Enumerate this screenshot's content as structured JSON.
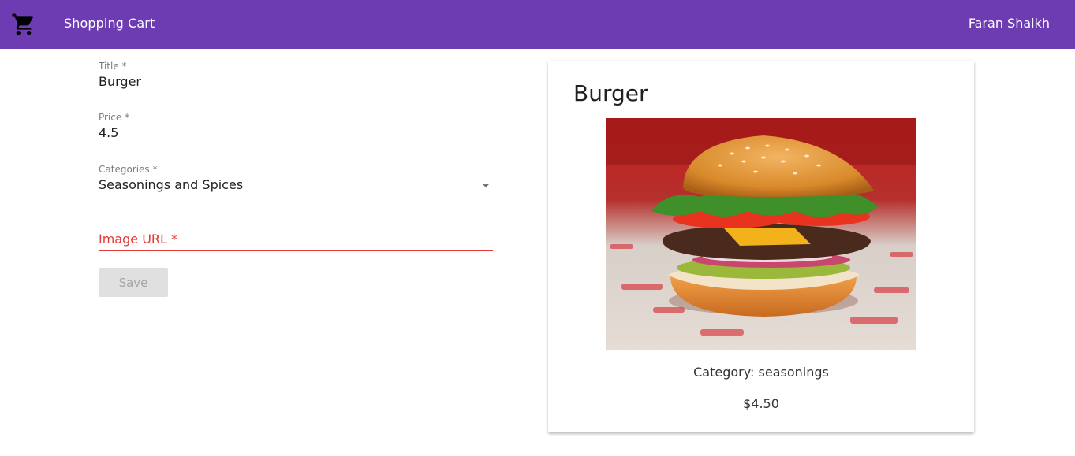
{
  "app": {
    "brand": "Shopping Cart",
    "user_name": "Faran Shaikh",
    "toolbar_color": "#6d3bb2",
    "cart_icon": "shopping-cart-icon"
  },
  "form": {
    "title": {
      "label": "Title *",
      "value": "Burger"
    },
    "price": {
      "label": "Price *",
      "value": "4.5"
    },
    "categories": {
      "label": "Categories *",
      "value": "Seasonings and Spices"
    },
    "image_url": {
      "placeholder": "Image URL *",
      "value": ""
    },
    "save_label": "Save",
    "error_color": "#e53935"
  },
  "preview": {
    "title": "Burger",
    "image": "burger-photo",
    "category_text": "Category: seasonings",
    "price_text": "$4.50"
  }
}
